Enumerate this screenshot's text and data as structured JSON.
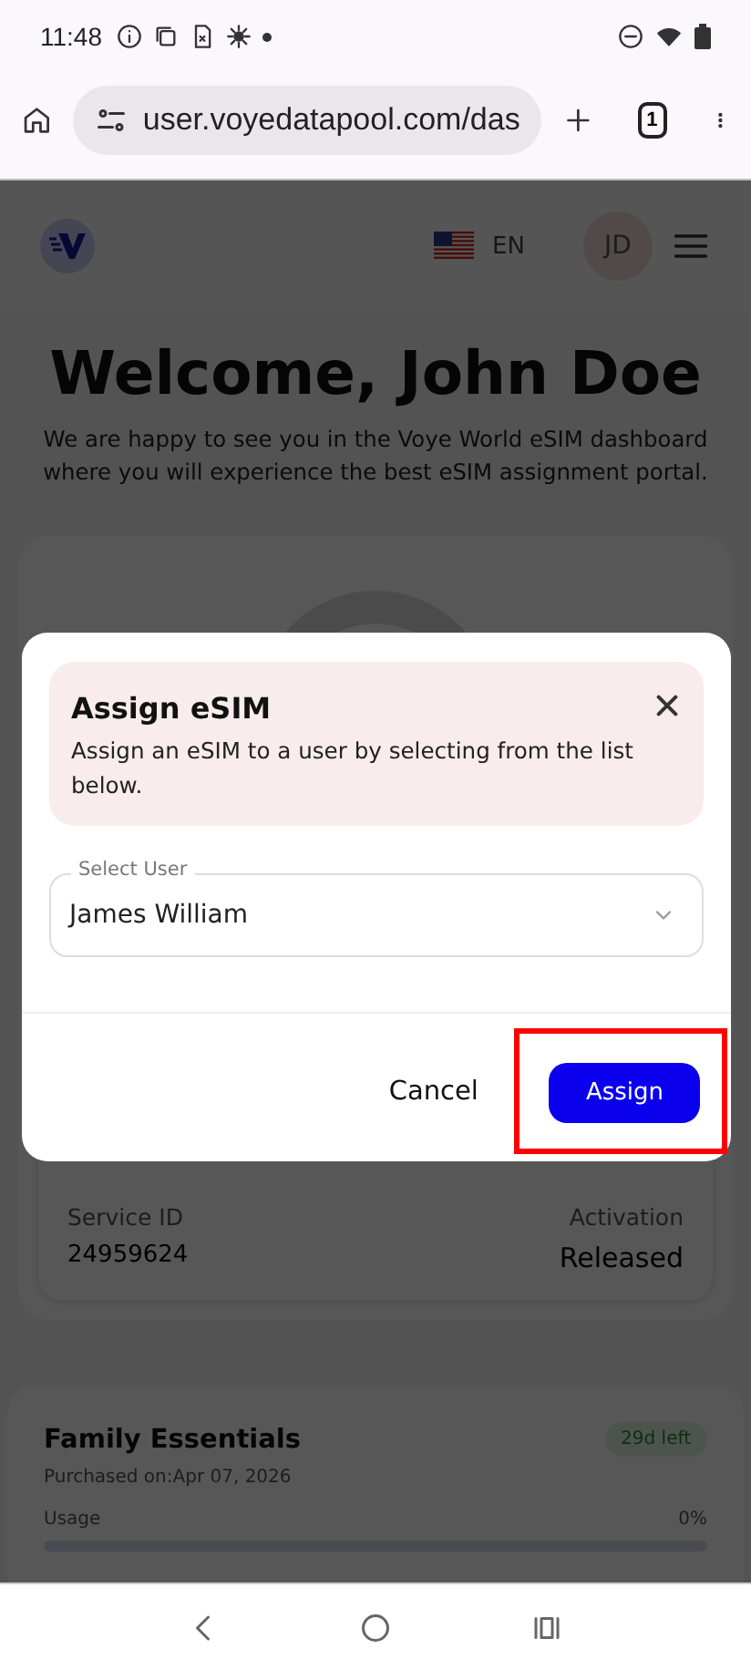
{
  "status_bar": {
    "time": "11:48"
  },
  "browser": {
    "url": "user.voyedatapool.com/das",
    "tab_count": "1"
  },
  "header": {
    "language": "EN",
    "avatar_initials": "JD"
  },
  "welcome": {
    "title": "Welcome, John Doe",
    "subtitle": "We are happy to see you in the Voye World eSIM dashboard where you will experience the best eSIM assignment portal."
  },
  "esim_card": {
    "fields": [
      {
        "label": "Service ID",
        "value": "24959624"
      },
      {
        "label": "Activation",
        "value": "Released"
      }
    ]
  },
  "plan_card": {
    "title": "Family Essentials",
    "purchased": "Purchased on:Apr 07, 2026",
    "badge": "29d left",
    "usage_label": "Usage",
    "usage_reading": "0%",
    "level": 0
  },
  "dialog": {
    "title": "Assign eSIM",
    "description": "Assign an eSIM to a user by selecting from the list below.",
    "select": {
      "label": "Select User",
      "value": "James William"
    },
    "buttons": [
      {
        "label": "Cancel",
        "kind": "text",
        "highlighted": false
      },
      {
        "label": "Assign",
        "kind": "primary",
        "highlighted": true
      }
    ]
  }
}
